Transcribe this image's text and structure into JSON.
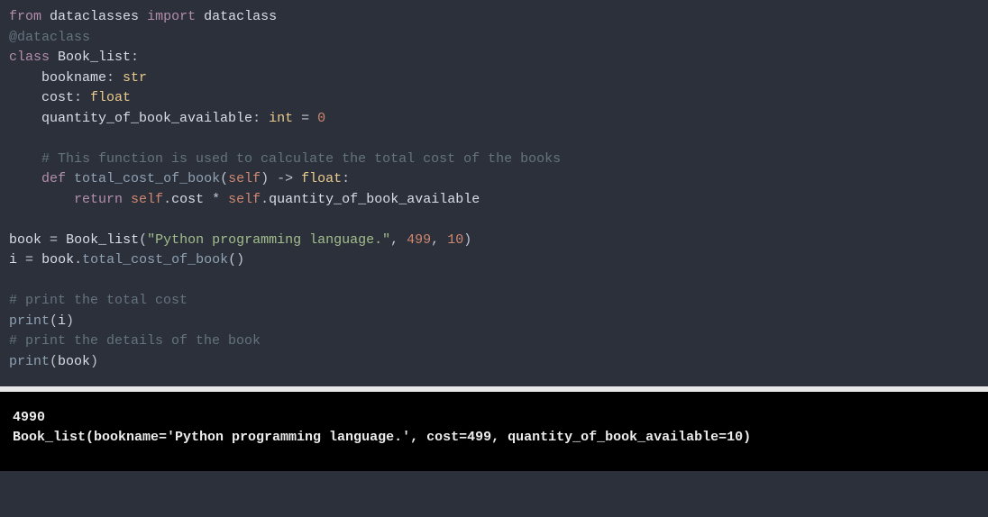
{
  "code": {
    "l1_from": "from",
    "l1_mod": "dataclasses",
    "l1_import": "import",
    "l1_name": "dataclass",
    "l2_dec": "@dataclass",
    "l3_class": "class",
    "l3_name": "Book_list",
    "l3_colon": ":",
    "l4_field": "bookname",
    "l4_type": "str",
    "l5_field": "cost",
    "l5_type": "float",
    "l6_field": "quantity_of_book_available",
    "l6_type": "int",
    "l6_eq": "=",
    "l6_val": "0",
    "l8_comment": "# This function is used to calculate the total cost of the books",
    "l9_def": "def",
    "l9_name": "total_cost_of_book",
    "l9_self": "self",
    "l9_arrow": "->",
    "l9_ret": "float",
    "l10_return": "return",
    "l10_self1": "self",
    "l10_attr1": "cost",
    "l10_star": "*",
    "l10_self2": "self",
    "l10_attr2": "quantity_of_book_available",
    "l12_var": "book",
    "l12_eq": "=",
    "l12_cls": "Book_list",
    "l12_str": "\"Python programming language.\"",
    "l12_n1": "499",
    "l12_n2": "10",
    "l13_var": "i",
    "l13_eq": "=",
    "l13_obj": "book",
    "l13_meth": "total_cost_of_book",
    "l15_comment": "# print the total cost",
    "l16_print": "print",
    "l16_arg": "i",
    "l17_comment": "# print the details of the book",
    "l18_print": "print",
    "l18_arg": "book"
  },
  "output": {
    "line1": "4990",
    "line2": "Book_list(bookname='Python programming language.', cost=499, quantity_of_book_available=10)"
  }
}
